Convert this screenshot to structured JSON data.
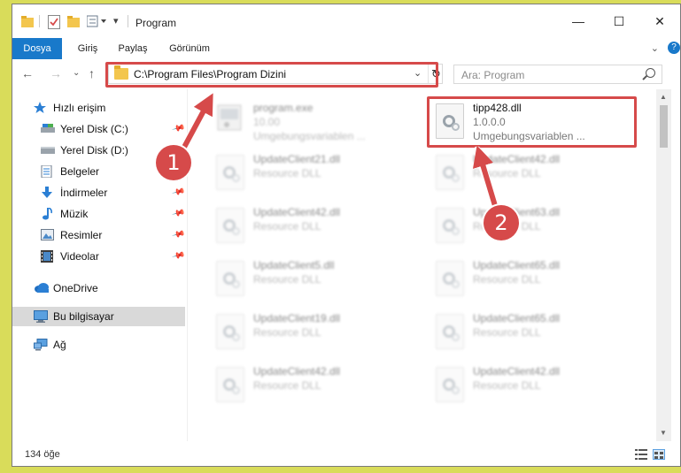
{
  "window": {
    "title": "Program",
    "controls": {
      "minimize": "—",
      "maximize": "☐",
      "close": "✕"
    }
  },
  "ribbon": {
    "tabs": [
      {
        "label": "Dosya",
        "active": true
      },
      {
        "label": "Giriş"
      },
      {
        "label": "Paylaş"
      },
      {
        "label": "Görünüm"
      }
    ],
    "expand_icon": "⌄",
    "help_icon": "?"
  },
  "nav": {
    "back": "←",
    "forward": "→",
    "recent": "⌄",
    "up": "↑",
    "address": "C:\\Program Files\\Program Dizini",
    "address_chevron": "⌄",
    "refresh": "↻",
    "search_placeholder": "Ara: Program"
  },
  "sidebar": {
    "items": [
      {
        "label": "Hızlı erişim",
        "icon": "star-icon"
      },
      {
        "label": "Yerel Disk (C:)",
        "icon": "drive-icon",
        "pinned": true
      },
      {
        "label": "Yerel Disk (D:)",
        "icon": "drive-icon"
      },
      {
        "label": "Belgeler",
        "icon": "documents-icon"
      },
      {
        "label": "İndirmeler",
        "icon": "downloads-icon",
        "pinned": true
      },
      {
        "label": "Müzik",
        "icon": "music-icon",
        "pinned": true
      },
      {
        "label": "Resimler",
        "icon": "pictures-icon",
        "pinned": true
      },
      {
        "label": "Videolar",
        "icon": "videos-icon",
        "pinned": true
      },
      {
        "label": "OneDrive",
        "icon": "cloud-icon"
      },
      {
        "label": "Bu bilgisayar",
        "icon": "computer-icon",
        "selected": true
      },
      {
        "label": "Ağ",
        "icon": "network-icon"
      }
    ],
    "pin_glyph": "📌"
  },
  "files": [
    {
      "name": "program.exe",
      "line2": "10.00",
      "line3": "Umgebungsvariablen ...",
      "blurred": true,
      "kind": "exe"
    },
    {
      "name": "tipp428.dll",
      "line2": "1.0.0.0",
      "line3": "Umgebungsvariablen ...",
      "blurred": false,
      "kind": "dll"
    },
    {
      "name": "UpdateClient21.dll",
      "line2": "Resource DLL",
      "blurred": true,
      "kind": "dll"
    },
    {
      "name": "UpdateClient42.dll",
      "line2": "Resource DLL",
      "blurred": true,
      "kind": "dll"
    },
    {
      "name": "UpdateClient42.dll",
      "line2": "Resource DLL",
      "blurred": true,
      "kind": "dll"
    },
    {
      "name": "UpdateClient63.dll",
      "line2": "Resource DLL",
      "blurred": true,
      "kind": "dll"
    },
    {
      "name": "UpdateClient5.dll",
      "line2": "Resource DLL",
      "blurred": true,
      "kind": "dll"
    },
    {
      "name": "UpdateClient65.dll",
      "line2": "Resource DLL",
      "blurred": true,
      "kind": "dll"
    },
    {
      "name": "UpdateClient19.dll",
      "line2": "Resource DLL",
      "blurred": true,
      "kind": "dll"
    },
    {
      "name": "UpdateClient65.dll",
      "line2": "Resource DLL",
      "blurred": true,
      "kind": "dll"
    },
    {
      "name": "UpdateClient42.dll",
      "line2": "Resource DLL",
      "blurred": true,
      "kind": "dll"
    },
    {
      "name": "UpdateClient42.dll",
      "line2": "Resource DLL",
      "blurred": true,
      "kind": "dll"
    }
  ],
  "status": {
    "item_count": "134 öğe"
  },
  "callouts": {
    "step1": "1",
    "step2": "2"
  },
  "colors": {
    "accent": "#1979ca",
    "highlight": "#d64a4a"
  }
}
